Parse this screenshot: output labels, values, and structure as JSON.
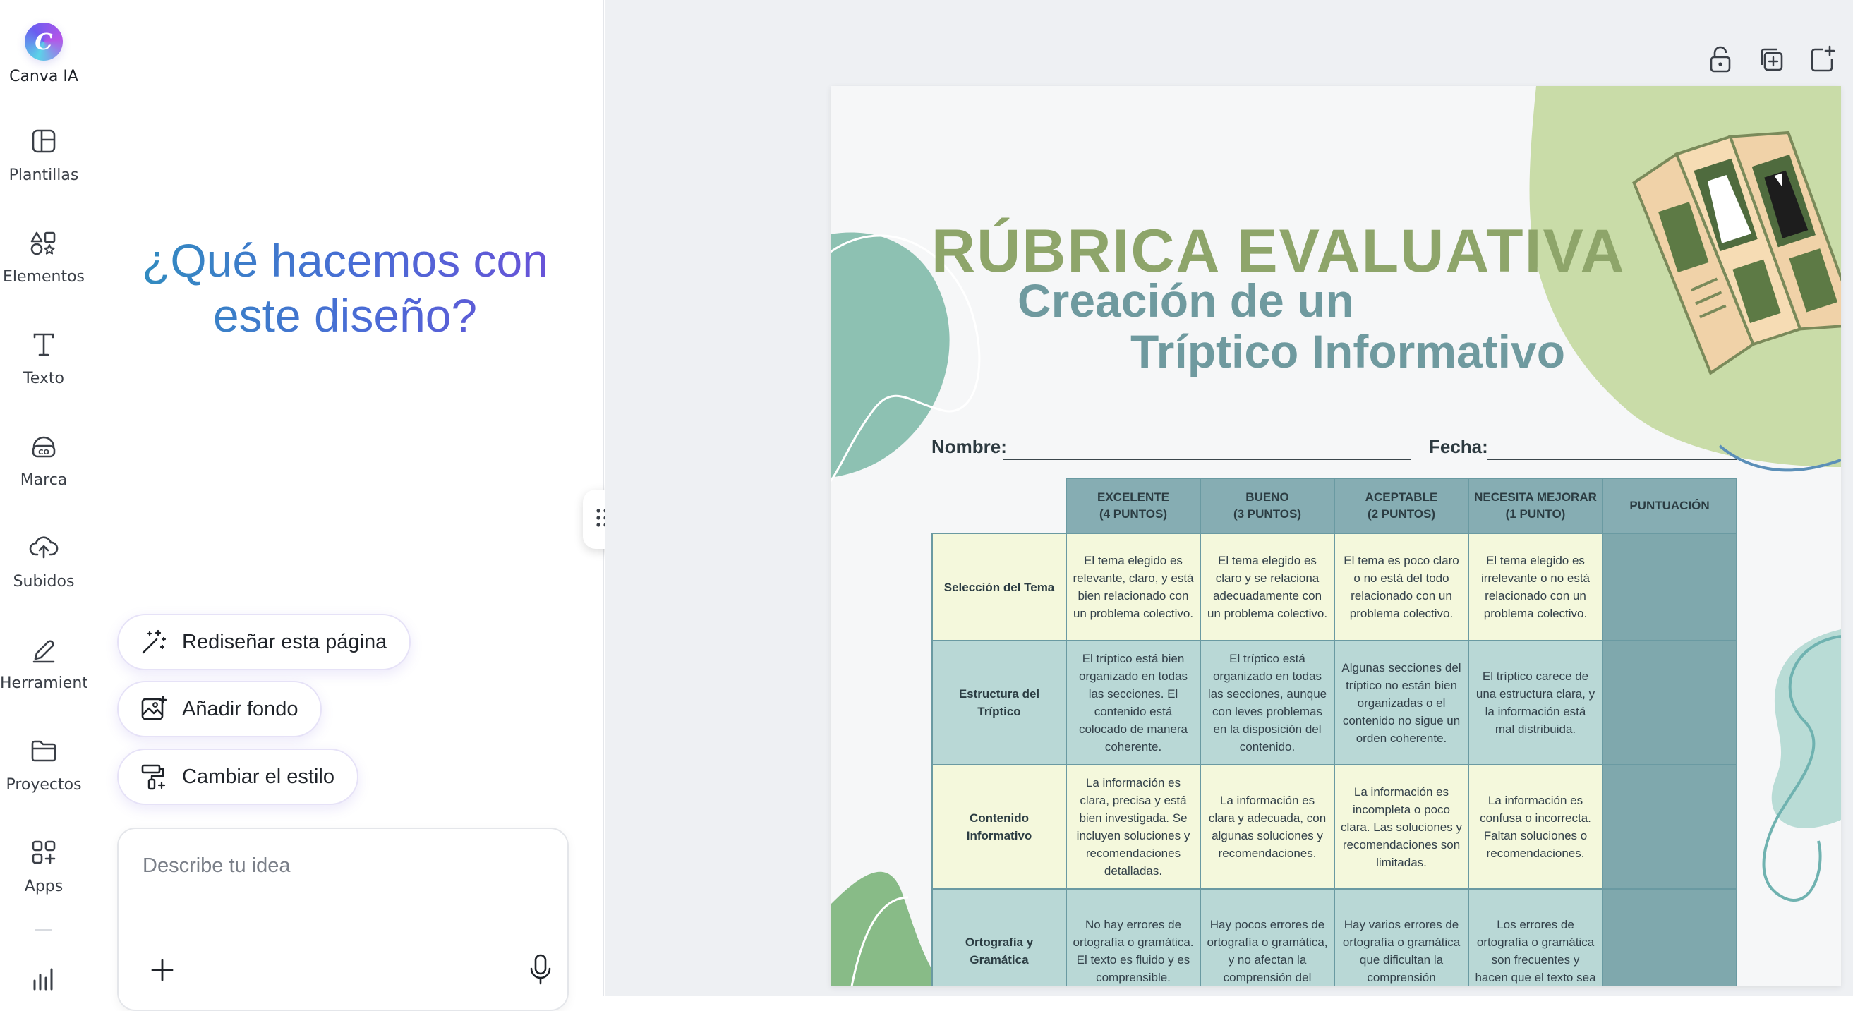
{
  "sidebar": {
    "logo": {
      "icon": "canva-logo-icon",
      "letter": "C",
      "label": "Canva IA"
    },
    "items": [
      {
        "id": "plantillas",
        "label": "Plantillas",
        "icon": "templates-icon"
      },
      {
        "id": "elementos",
        "label": "Elementos",
        "icon": "elements-icon"
      },
      {
        "id": "texto",
        "label": "Texto",
        "icon": "text-icon"
      },
      {
        "id": "marca",
        "label": "Marca",
        "icon": "brand-icon"
      },
      {
        "id": "subidos",
        "label": "Subidos",
        "icon": "upload-icon"
      },
      {
        "id": "herramientas",
        "label": "Herramient...",
        "icon": "tools-icon"
      },
      {
        "id": "proyectos",
        "label": "Proyectos",
        "icon": "folder-icon"
      },
      {
        "id": "apps",
        "label": "Apps",
        "icon": "apps-icon"
      },
      {
        "id": "insights",
        "label": "",
        "icon": "bar-chart-icon"
      }
    ]
  },
  "ai_panel": {
    "heading": "¿Qué hacemos con este diseño?",
    "suggestions": [
      {
        "label": "Rediseñar esta página",
        "icon": "magic-wand-icon"
      },
      {
        "label": "Añadir fondo",
        "icon": "image-add-icon"
      },
      {
        "label": "Cambiar el estilo",
        "icon": "paint-roller-icon"
      }
    ],
    "prompt": {
      "placeholder": "Describe tu idea",
      "value": ""
    }
  },
  "canvas_toolbar": {
    "icons": [
      "lock-icon",
      "duplicate-page-icon",
      "add-page-icon"
    ]
  },
  "design": {
    "title": "RÚBRICA EVALUATIVA",
    "subtitle_line1": "Creación de un",
    "subtitle_line2": "Tríptico Informativo",
    "name_label": "Nombre:",
    "date_label": "Fecha:",
    "colors": {
      "title": "#8ea56a",
      "subtitle": "#6f9a9f",
      "header_fill": "#86adb3",
      "row_light": "#f4f8dc",
      "row_teal": "#b9d8d6",
      "score_fill": "#7fa8ad",
      "blob_green": "#8dc1b2",
      "blob_olive": "#c9dca8"
    },
    "table": {
      "headers": [
        "EXCELENTE\n(4 PUNTOS)",
        "BUENO\n(3 PUNTOS)",
        "ACEPTABLE\n(2 PUNTOS)",
        "NECESITA MEJORAR\n(1 PUNTO)",
        "PUNTUACIÓN"
      ],
      "rows": [
        {
          "criterion": "Selección del Tema",
          "style": "light",
          "cells": [
            "El tema elegido es relevante, claro, y está bien relacionado con un problema colectivo.",
            "El tema elegido es claro y se relaciona adecuadamente con un problema colectivo.",
            "El tema es poco claro o no está del todo relacionado con un problema colectivo.",
            "El tema elegido es irrelevante o no está relacionado con un problema colectivo."
          ],
          "score": ""
        },
        {
          "criterion": "Estructura del Tríptico",
          "style": "teal",
          "cells": [
            "El tríptico está bien organizado en todas las secciones. El contenido está colocado de manera coherente.",
            "El tríptico está organizado en todas las secciones, aunque con leves problemas en la disposición del contenido.",
            "Algunas secciones del tríptico no están bien organizadas o el contenido no sigue un orden coherente.",
            "El tríptico carece de una estructura clara, y la información está mal distribuida."
          ],
          "score": ""
        },
        {
          "criterion": "Contenido Informativo",
          "style": "light",
          "cells": [
            "La información es clara, precisa y está bien investigada. Se incluyen soluciones y recomendaciones detalladas.",
            "La información es clara y adecuada, con algunas soluciones y recomendaciones.",
            "La información es incompleta o poco clara. Las soluciones y recomendaciones son limitadas.",
            "La información es confusa o incorrecta. Faltan soluciones o recomendaciones."
          ],
          "score": ""
        },
        {
          "criterion": "Ortografía y Gramática",
          "style": "teal",
          "cells": [
            "No hay errores de ortografía o gramática. El texto es fluido y es comprensible.",
            "Hay pocos errores de ortografía o gramática, y no afectan la comprensión del",
            "Hay varios errores de ortografía o gramática que dificultan la comprensión",
            "Los errores de ortografía o gramática son frecuentes y hacen que el texto sea"
          ],
          "score": ""
        }
      ]
    }
  }
}
